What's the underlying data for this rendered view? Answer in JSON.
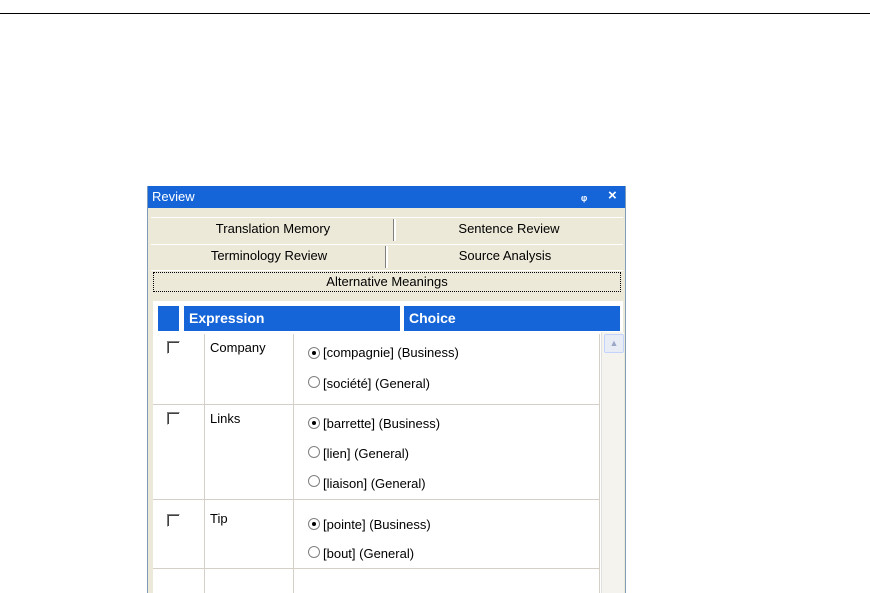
{
  "panel": {
    "title": "Review",
    "pin_glyph": "ᵩ",
    "close_glyph": "×",
    "pin_icon": "pin-icon",
    "close_icon": "close-icon"
  },
  "tabs": {
    "row1": [
      "Translation Memory",
      "Sentence Review"
    ],
    "row2": [
      "Terminology Review",
      "Source Analysis"
    ],
    "active": "Alternative Meanings"
  },
  "grid": {
    "columns": [
      "Expression",
      "Choice"
    ],
    "rows": [
      {
        "expression": "Company",
        "checked": false,
        "options": [
          {
            "label": "[compagnie] (Business)",
            "selected": true
          },
          {
            "label": "[société] (General)",
            "selected": false
          }
        ]
      },
      {
        "expression": "Links",
        "checked": false,
        "options": [
          {
            "label": "[barrette] (Business)",
            "selected": true
          },
          {
            "label": "[lien] (General)",
            "selected": false
          },
          {
            "label": "[liaison] (General)",
            "selected": false
          }
        ]
      },
      {
        "expression": "Tip",
        "checked": false,
        "options": [
          {
            "label": "[pointe] (Business)",
            "selected": true
          },
          {
            "label": "[bout] (General)",
            "selected": false
          }
        ]
      }
    ]
  },
  "colors": {
    "titlebar": "#1665d8",
    "header": "#1665d8",
    "panel_bg": "#ece9d8"
  }
}
